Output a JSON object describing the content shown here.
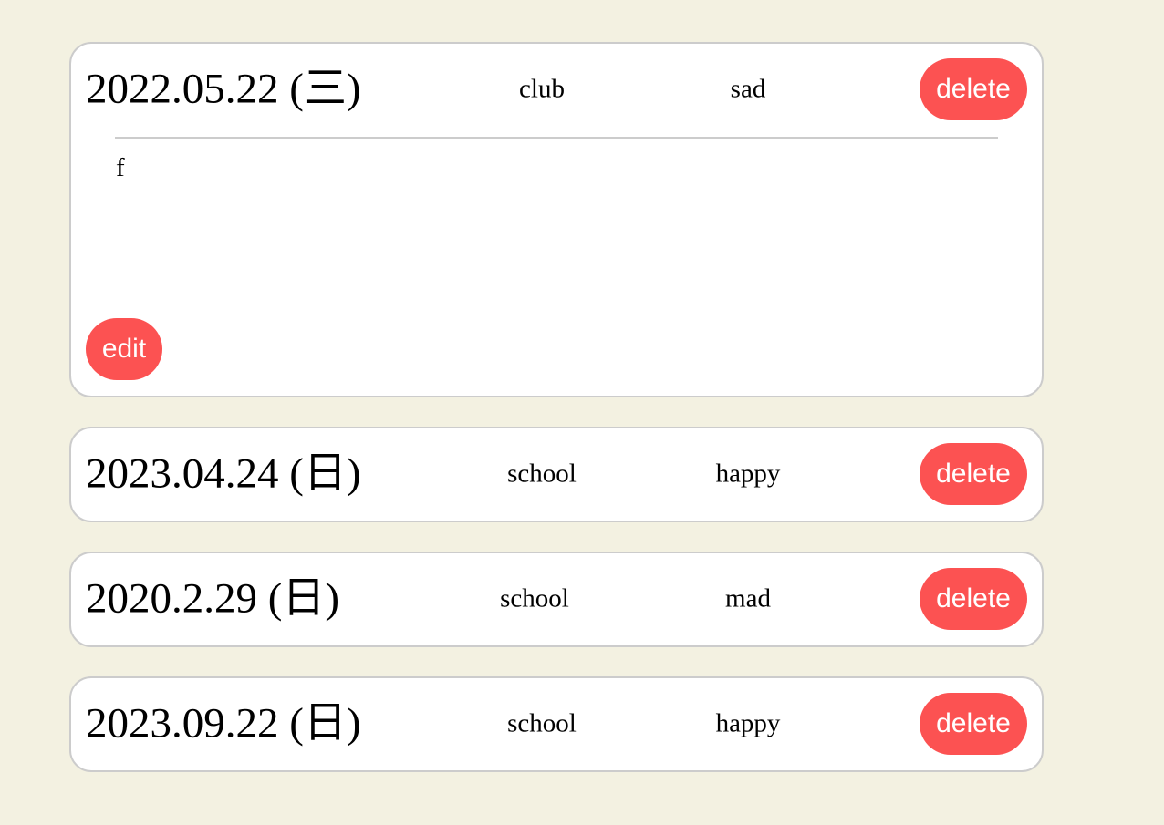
{
  "entries": [
    {
      "date": "2022.05.22 (三)",
      "category": "club",
      "mood": "sad",
      "delete_label": "delete",
      "content": "f",
      "edit_label": "edit",
      "expanded": true
    },
    {
      "date": "2023.04.24 (日)",
      "category": "school",
      "mood": "happy",
      "delete_label": "delete"
    },
    {
      "date": "2020.2.29 (日)",
      "category": "school",
      "mood": "mad",
      "delete_label": "delete"
    },
    {
      "date": "2023.09.22 (日)",
      "category": "school",
      "mood": "happy",
      "delete_label": "delete"
    }
  ],
  "colors": {
    "background": "#f3f1e1",
    "card": "#ffffff",
    "border": "#cccccc",
    "button": "#fc5252",
    "button_text": "#ffffff"
  }
}
